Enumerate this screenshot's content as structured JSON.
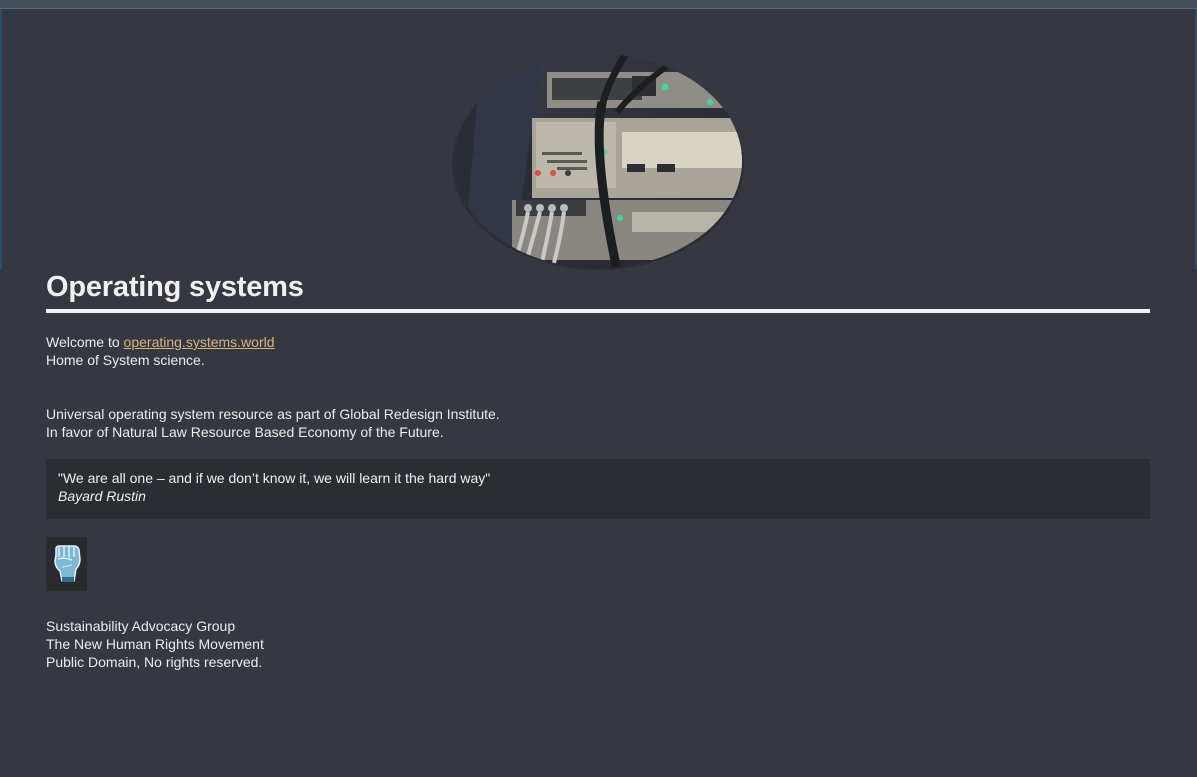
{
  "page": {
    "title": "Operating systems"
  },
  "intro": {
    "welcome_prefix": "Welcome to ",
    "site_link": "operating.systems.world",
    "tagline": "Home of System science."
  },
  "about": {
    "line1": "Universal operating system resource as part of Global Redesign Institute.",
    "line2": "In favor of Natural Law Resource Based Economy of the Future."
  },
  "quote": {
    "text": "\"We are all one – and if we don’t know it, we will learn it the hard way\"",
    "author": "Bayard Rustin"
  },
  "badge": {
    "icon": "raised-fist-icon"
  },
  "footer": {
    "line1": "Sustainability Advocacy Group",
    "line2": "The New Human Rights Movement",
    "line3": "Public Domain, No rights reserved."
  },
  "colors": {
    "background": "#353841",
    "link": "#d8b47a",
    "quote_bg": "#2c2d32"
  }
}
